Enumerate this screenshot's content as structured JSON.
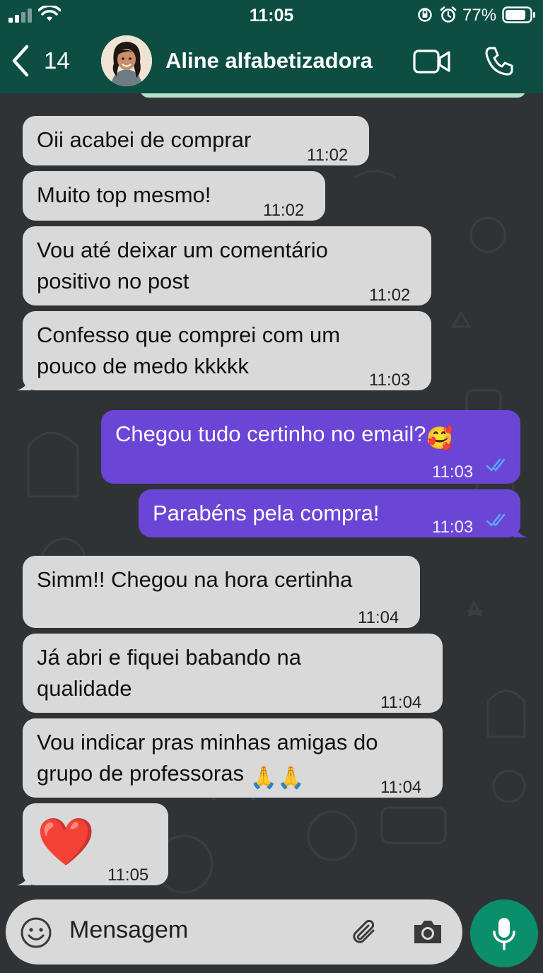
{
  "status_bar": {
    "time": "11:05",
    "battery": "77%"
  },
  "header": {
    "unread_count": "14",
    "contact_name": "Aline alfabetizadora"
  },
  "messages": [
    {
      "text": "Oii acabei de comprar",
      "time": "11:02"
    },
    {
      "text": "Muito top mesmo!",
      "time": "11:02"
    },
    {
      "text_line1": "Vou até deixar um comentário",
      "text_line2": "positivo no post",
      "time": "11:02"
    },
    {
      "text_line1": "Confesso que comprei com um",
      "text_line2": "pouco de medo kkkkk",
      "time": "11:03"
    },
    {
      "text": "Chegou tudo certinho no email?",
      "emoji": "🥰",
      "time": "11:03"
    },
    {
      "text": "Parabéns pela compra!",
      "time": "11:03"
    },
    {
      "text": "Simm!! Chegou na hora certinha",
      "time": "11:04"
    },
    {
      "text_line1": "Já abri e fiquei babando na",
      "text_line2": "qualidade",
      "time": "11:04"
    },
    {
      "text_line1": "Vou indicar pras minhas amigas do",
      "text_line2": "grupo de professoras",
      "emoji": "🙏🙏",
      "time": "11:04"
    },
    {
      "emoji": "❤️",
      "time": "11:05"
    }
  ],
  "input": {
    "placeholder": "Mensagem"
  },
  "colors": {
    "header": "#0d4e43",
    "incoming": "#d9d9d9",
    "outgoing": "#6b46d6",
    "mic": "#0b8f6b",
    "read_ticks": "#5aa9ff"
  }
}
